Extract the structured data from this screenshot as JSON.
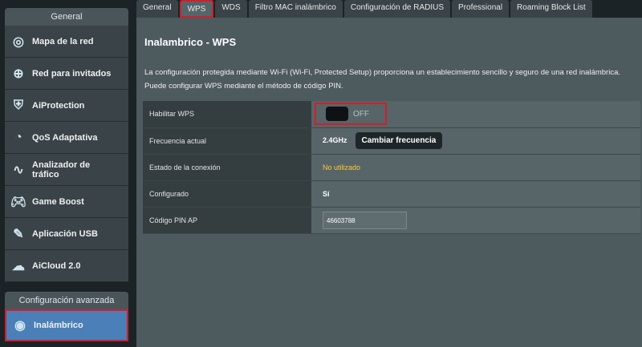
{
  "sidebar": {
    "general_label": "General",
    "items": [
      {
        "label": "Mapa de la red",
        "icon": "network-map-icon"
      },
      {
        "label": "Red para invitados",
        "icon": "guest-network-icon"
      },
      {
        "label": "AiProtection",
        "icon": "shield-icon"
      },
      {
        "label": "QoS Adaptativa",
        "icon": "gauge-icon"
      },
      {
        "label": "Analizador de tráfico",
        "icon": "traffic-icon"
      },
      {
        "label": "Game Boost",
        "icon": "gamepad-icon"
      },
      {
        "label": "Aplicación USB",
        "icon": "usb-icon"
      },
      {
        "label": "AiCloud 2.0",
        "icon": "cloud-icon"
      }
    ],
    "advanced_label": "Configuración avanzada",
    "active_item": {
      "label": "Inalámbrico",
      "icon": "wifi-icon"
    }
  },
  "tabs": [
    "General",
    "WPS",
    "WDS",
    "Filtro MAC inalámbrico",
    "Configuración de RADIUS",
    "Professional",
    "Roaming Block List"
  ],
  "page": {
    "title": "Inalambrico - WPS",
    "description": "La configuración protegida mediante Wi-Fi (Wi-Fi, Protected Setup) proporciona un establecimiento sencillo y seguro de una red inalámbrica. Puede configurar WPS mediante el método de código PIN.",
    "rows": {
      "enable_label": "Habilitar WPS",
      "enable_value": "OFF",
      "freq_label": "Frecuencia actual",
      "freq_value": "2.4GHz",
      "freq_button": "Cambiar frecuencia",
      "status_label": "Estado de la conexión",
      "status_value": "No utilizado",
      "configured_label": "Configurado",
      "configured_value": "Sí",
      "pin_label": "Código PIN AP",
      "pin_value": "46603788"
    }
  }
}
